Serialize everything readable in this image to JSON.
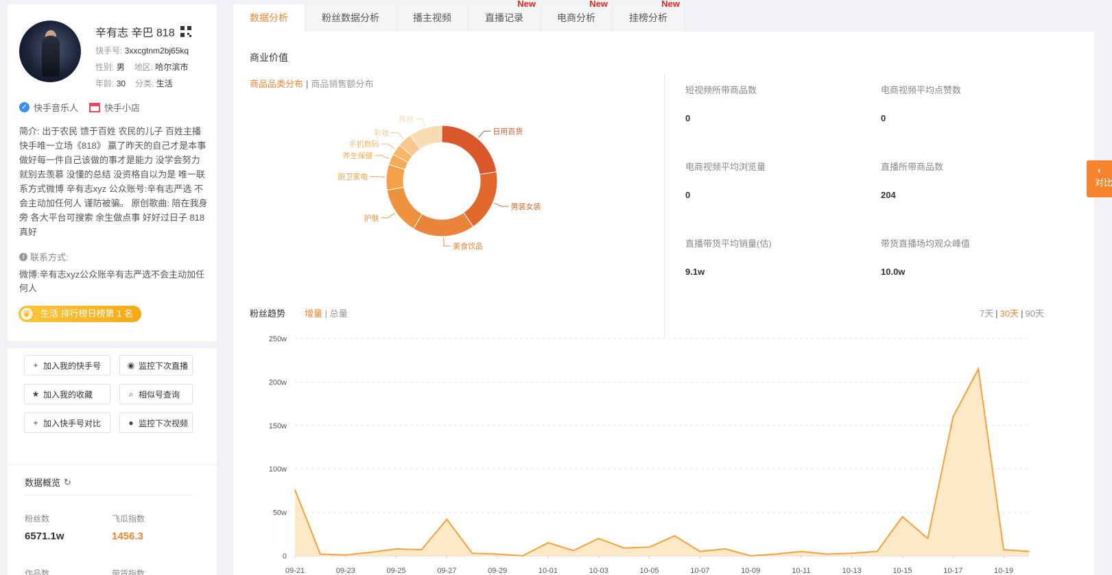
{
  "profile": {
    "name": "辛有志 辛巴 818",
    "id_label": "快手号:",
    "id_value": "3xxcgtnm2bj65kq",
    "gender_label": "性别:",
    "gender": "男",
    "region_label": "地区:",
    "region": "哈尔滨市",
    "age_label": "年龄:",
    "age": "30",
    "category_label": "分类:",
    "category": "生活",
    "badge1": "快手音乐人",
    "badge2": "快手小店",
    "bio": "简介:  出于农民 馈于百姓 农民的儿子 百姓主播 快手唯一立场《818》 赢了昨天的自己才是本事 做好每一件自己该做的事才是能力 没学会努力 就别去羡慕 没懂的总结 没资格自以为是 唯一联系方式微博 辛有志xyz 公众账号:辛有志严选 不会主动加任何人 谨防被骗。 原创歌曲: 陪在我身旁 各大平台可搜索 余生做点事 好好过日子 818真好",
    "contact_label": "联系方式:",
    "contact": "微博:辛有志xyz公众账辛有志严选不会主动加任何人",
    "rank": "生活 排行榜日榜第 1 名"
  },
  "actions": {
    "add_my": "加入我的快手号",
    "monitor_live": "监控下次直播",
    "add_fav": "加入我的收藏",
    "similar": "相似号查询",
    "add_compare": "加入快手号对比",
    "monitor_video": "监控下次视频"
  },
  "overview": {
    "title": "数据概览",
    "fans_label": "粉丝数",
    "fans": "6571.1w",
    "index_label": "飞瓜指数",
    "index": "1456.3",
    "works_label": "作品数",
    "goods_index_label": "带货指数"
  },
  "tabs": [
    {
      "label": "数据分析",
      "new": ""
    },
    {
      "label": "粉丝数据分析",
      "new": ""
    },
    {
      "label": "播主视频",
      "new": ""
    },
    {
      "label": "直播记录",
      "new": "New"
    },
    {
      "label": "电商分析",
      "new": "New"
    },
    {
      "label": "挂榜分析",
      "new": "New"
    }
  ],
  "commerce": {
    "title": "商业价值",
    "tab_active": "商品品类分布",
    "tab_sep": "|",
    "tab_other": "商品销售额分布",
    "metrics": [
      {
        "label": "短视频所带商品数",
        "value": "0"
      },
      {
        "label": "电商视频平均点赞数",
        "value": "0"
      },
      {
        "label": "电商视频平均浏览量",
        "value": "0"
      },
      {
        "label": "直播所带商品数",
        "value": "204"
      },
      {
        "label": "直播带货平均销量(估)",
        "value": "9.1w"
      },
      {
        "label": "带货直播场均观众峰值",
        "value": "10.0w"
      }
    ]
  },
  "donut_data": {
    "type": "pie",
    "categories": [
      "日用百货",
      "男装女装",
      "美食饮品",
      "护肤",
      "厨卫家电",
      "养生保健",
      "手机数码",
      "彩妆",
      "其他"
    ],
    "values": [
      21,
      17,
      17,
      13,
      7,
      3,
      3,
      4,
      9
    ],
    "colors": [
      "#d9572a",
      "#e2692c",
      "#e9843a",
      "#ef923f",
      "#f3a048",
      "#f5ab55",
      "#f6b868",
      "#f8c88c",
      "#fadcb4"
    ]
  },
  "trend": {
    "title": "粉丝趋势",
    "tab_active": "增量",
    "tab_sep": "|",
    "tab_other": "总量",
    "range_7": "7天",
    "range_30": "30天",
    "range_90": "90天",
    "range_sep": "|"
  },
  "chart_data": {
    "type": "area",
    "x": [
      "09-21",
      "09-22",
      "09-23",
      "09-24",
      "09-25",
      "09-26",
      "09-27",
      "09-28",
      "09-29",
      "09-30",
      "10-01",
      "10-02",
      "10-03",
      "10-04",
      "10-05",
      "10-06",
      "10-07",
      "10-08",
      "10-09",
      "10-10",
      "10-11",
      "10-12",
      "10-13",
      "10-14",
      "10-15",
      "10-16",
      "10-17",
      "10-18",
      "10-19",
      "10-20"
    ],
    "x_tick_labels": [
      "09-21",
      "09-23",
      "09-25",
      "09-27",
      "09-29",
      "10-01",
      "10-03",
      "10-05",
      "10-07",
      "10-09",
      "10-11",
      "10-13",
      "10-15",
      "10-17",
      "10-19"
    ],
    "values": [
      76,
      2,
      1,
      4,
      8,
      7,
      42,
      3,
      2,
      0,
      15,
      6,
      20,
      9,
      10,
      23,
      5,
      8,
      0,
      2,
      5,
      2,
      3,
      5,
      45,
      20,
      160,
      215,
      7,
      5
    ],
    "ylim": [
      0,
      250
    ],
    "yticks": [
      "0",
      "50w",
      "100w",
      "150w",
      "200w",
      "250w"
    ],
    "color": "#f7a13a",
    "fill": "#fde7c4"
  },
  "compare": {
    "label": "对比"
  }
}
